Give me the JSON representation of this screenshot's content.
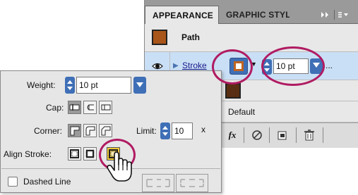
{
  "appearance_panel": {
    "tabs": [
      {
        "label": "APPEARANCE"
      },
      {
        "label": "GRAPHIC STYL"
      }
    ],
    "more_tabs_icon": "double-chevron-right-icon",
    "menu_icon": "panel-menu-icon",
    "path_row": {
      "label": "Path",
      "swatch_color": "#a9561a"
    },
    "stroke_row": {
      "label": "Stroke",
      "swatch_color": "#c0631f",
      "weight_value": "10 pt",
      "ellipsis": "..."
    },
    "fill_row": {
      "swatch_color": "#5a2e12"
    },
    "opacity_row": {
      "label": "Default"
    },
    "toolbar": {
      "fx_label": "fx",
      "icons": [
        "new-art-icon",
        "fx-icon",
        "clear-icon",
        "duplicate-icon",
        "trash-icon"
      ]
    },
    "selected_row_color": "#c9dff5"
  },
  "stroke_panel": {
    "weight_label": "Weight:",
    "weight_value": "10 pt",
    "cap_label": "Cap:",
    "corner_label": "Corner:",
    "limit_label": "Limit:",
    "limit_value": "10",
    "limit_unit": "x",
    "align_label": "Align Stroke:",
    "dashed_label": "Dashed Line",
    "dashed_checked": false,
    "highlight_color": "#f0c93a"
  },
  "annotation_color": "#b01b62"
}
